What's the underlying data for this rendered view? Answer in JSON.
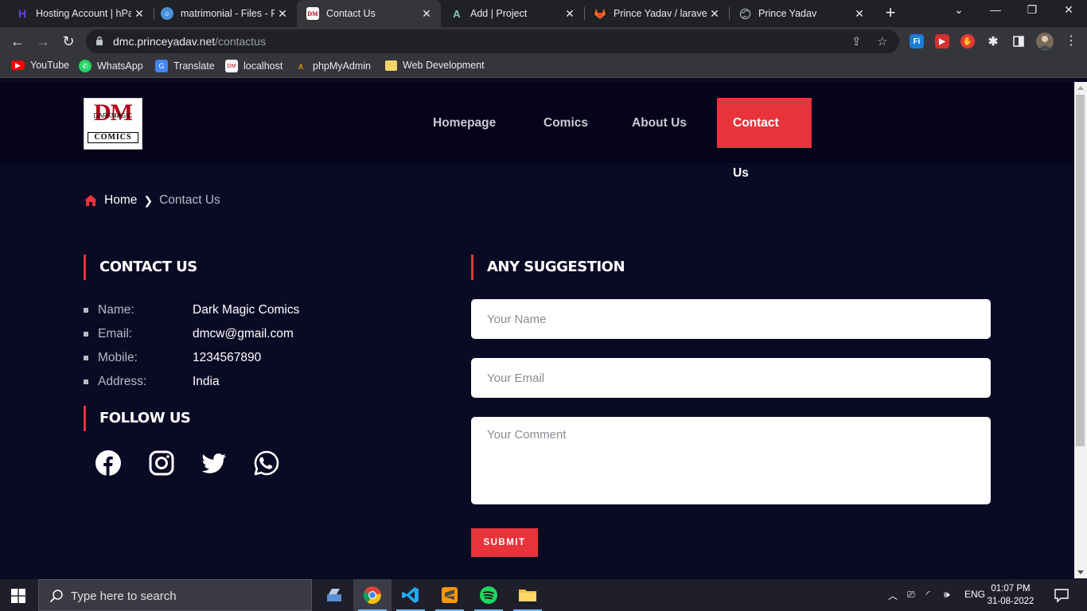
{
  "browser": {
    "tabs": [
      {
        "title": "Hosting Account | hPa",
        "icon": "hostinger-icon",
        "color": "#673de6"
      },
      {
        "title": "matrimonial - Files - Fi",
        "icon": "files-icon",
        "color": "#4a90d9"
      },
      {
        "title": "Contact Us",
        "icon": "dm-comics-icon",
        "color": "#b3001b"
      },
      {
        "title": "Add | Project",
        "icon": "admin-a-icon",
        "color": "#2e7d6b"
      },
      {
        "title": "Prince Yadav / laravel-",
        "icon": "gitlab-icon",
        "color": "#fc6d26"
      },
      {
        "title": "Prince Yadav",
        "icon": "globe-icon",
        "color": "#9aa0a6"
      }
    ],
    "url_domain": "dmc.princeyadav.net",
    "url_path": "/contactus",
    "bookmarks": [
      {
        "label": "YouTube",
        "icon": "youtube-icon",
        "color": "#ff0000"
      },
      {
        "label": "WhatsApp",
        "icon": "whatsapp-icon",
        "color": "#25d366"
      },
      {
        "label": "Translate",
        "icon": "translate-icon",
        "color": "#4285f4"
      },
      {
        "label": "localhost",
        "icon": "localhost-icon",
        "color": "#b3001b"
      },
      {
        "label": "phpMyAdmin",
        "icon": "phpmyadmin-icon",
        "color": "#f29111"
      },
      {
        "label": "Web Development",
        "icon": "folder-icon",
        "color": "#f5d36b"
      }
    ]
  },
  "site": {
    "logo": {
      "big": "DM",
      "small": "DARKMAGIC",
      "bottom": "COMICS"
    },
    "nav": [
      "Homepage",
      "Comics",
      "About Us",
      "Contact Us"
    ],
    "accent": "#e8333b",
    "breadcrumb": {
      "home": "Home",
      "current": "Contact Us"
    },
    "contact": {
      "title": "CONTACT US",
      "rows": [
        {
          "key": "Name:",
          "value": "Dark Magic Comics"
        },
        {
          "key": "Email:",
          "value": "dmcw@gmail.com"
        },
        {
          "key": "Mobile:",
          "value": "1234567890"
        },
        {
          "key": "Address:",
          "value": "India"
        }
      ]
    },
    "follow": {
      "title": "FOLLOW US",
      "icons": [
        "facebook-icon",
        "instagram-icon",
        "twitter-icon",
        "whatsapp-icon"
      ]
    },
    "suggestion": {
      "title": "ANY SUGGESTION",
      "name_placeholder": "Your Name",
      "email_placeholder": "Your Email",
      "comment_placeholder": "Your Comment",
      "submit": "SUBMIT"
    }
  },
  "taskbar": {
    "search_placeholder": "Type here to search",
    "apps": [
      "file-explorer-icon",
      "chrome-icon",
      "vscode-icon",
      "sublime-icon",
      "spotify-icon",
      "folder-icon"
    ],
    "lang": "ENG",
    "time": "01:07 PM",
    "date": "31-08-2022"
  }
}
